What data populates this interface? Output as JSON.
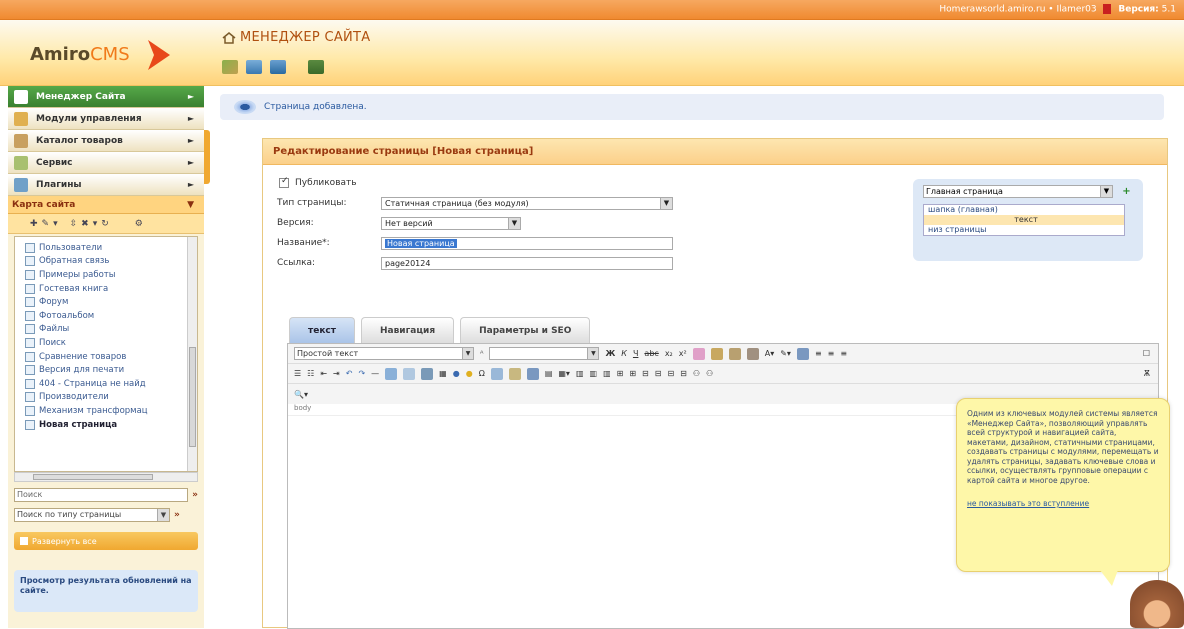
{
  "topbar": {
    "site": "Homerawsorld.amiro.ru",
    "user": "Ilamer03",
    "version_label": "Версия:",
    "version_value": "5.1"
  },
  "header": {
    "logo_main": "Amiro",
    "logo_cms": "CMS",
    "title": "МЕНЕДЖЕР САЙТА"
  },
  "sidebar": {
    "menu": [
      {
        "label": "Менеджер Сайта",
        "icon": "sitemap-icon"
      },
      {
        "label": "Модули управления",
        "icon": "modules-icon"
      },
      {
        "label": "Каталог товаров",
        "icon": "catalog-icon"
      },
      {
        "label": "Сервис",
        "icon": "tools-icon"
      },
      {
        "label": "Плагины",
        "icon": "plugins-icon"
      }
    ],
    "map_title": "Карта сайта",
    "tree": [
      "Пользователи",
      "Обратная связь",
      "Примеры работы",
      "Гостевая книга",
      "Форум",
      "Фотоальбом",
      "Файлы",
      "Поиск",
      "Сравнение товаров",
      "Версия для печати",
      "404 - Страница не найд",
      "Производители",
      "Механизм трансформац",
      "Новая страница"
    ],
    "search_placeholder": "Поиск",
    "search_scope": "Поиск по типу страницы",
    "expand_label": "Развернуть все",
    "preview_label": "Просмотр результата обновлений на сайте."
  },
  "notice": "Страница добавлена.",
  "panel": {
    "title": "Редактирование страницы [Новая страница]",
    "publish_label": "Публиковать",
    "type_label": "Тип страницы:",
    "type_value": "Статичная страница (без модуля)",
    "version_label": "Версия:",
    "version_value": "Нет версий",
    "name_label": "Название*:",
    "name_value": "Новая страница",
    "link_label": "Ссылка:",
    "link_value": "page20124",
    "parent_select": "Главная страница",
    "parent_tree": [
      "шапка (главная)",
      "текст",
      "низ страницы"
    ]
  },
  "tabs": [
    {
      "label": "текст",
      "active": true
    },
    {
      "label": "Навигация",
      "active": false
    },
    {
      "label": "Параметры и SEO",
      "active": false
    }
  ],
  "editor": {
    "format_select": "Простой текст",
    "path": "body"
  },
  "tooltip": {
    "text": "Одним из ключевых модулей системы является «Менеджер Сайта», позволяющий управлять всей структурой и навигацией сайта, макетами, дизайном, статичными страницами, создавать страницы с модулями, перемещать и удалять страницы, задавать ключевые слова и ссылки, осуществлять групповые операции с картой сайта и многое другое.",
    "link": "не показывать это вступление"
  }
}
